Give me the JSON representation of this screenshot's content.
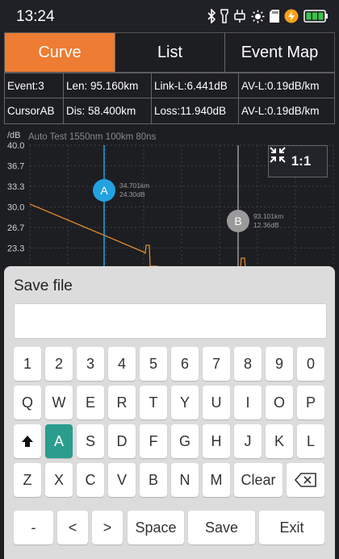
{
  "status": {
    "time": "13:24",
    "icons": [
      "bluetooth-icon",
      "flashlight-icon",
      "plug-icon",
      "brightness-icon",
      "sd-card-icon",
      "charging-icon",
      "battery-icon"
    ],
    "battery_color": "#3ec24a"
  },
  "tabs": [
    {
      "label": "Curve",
      "active": true
    },
    {
      "label": "List",
      "active": false
    },
    {
      "label": "Event Map",
      "active": false
    }
  ],
  "info": {
    "row1": [
      "Event:3",
      "Len: 95.160km",
      "Link-L:6.441dB",
      "AV-L:0.19dB/km"
    ],
    "row2": [
      "CursorAB",
      "Dis:  58.400km",
      "Loss:11.940dB",
      "AV-L:0.19dB/km"
    ]
  },
  "chart_data": {
    "type": "line",
    "title": "Auto Test  1550nm  100km  80ns",
    "ylabel": "/dB",
    "y_ticks": [
      "40.0",
      "36.7",
      "33.3",
      "30.0",
      "26.7",
      "23.3"
    ],
    "ylim": [
      20.0,
      40.0
    ],
    "grid": true,
    "cursors": [
      {
        "name": "A",
        "distance": "34.701km",
        "loss": "24.30dB",
        "color": "#23a2e0"
      },
      {
        "name": "B",
        "distance": "93.101km",
        "loss": "12.36dB",
        "color": "#9a9a9a"
      }
    ],
    "trace_color": "#e08a2c",
    "zoom_label": "1:1"
  },
  "dialog": {
    "title": "Save file",
    "filename_value": "",
    "accent": "#2a9d8f"
  },
  "keyboard": {
    "row1": [
      "1",
      "2",
      "3",
      "4",
      "5",
      "6",
      "7",
      "8",
      "9",
      "0"
    ],
    "row2": [
      "Q",
      "W",
      "E",
      "R",
      "T",
      "Y",
      "U",
      "I",
      "O",
      "P"
    ],
    "row3": [
      "A",
      "S",
      "D",
      "F",
      "G",
      "H",
      "J",
      "K",
      "L"
    ],
    "row4": [
      "Z",
      "X",
      "C",
      "V",
      "B",
      "N",
      "M"
    ],
    "clear_label": "Clear",
    "row5": [
      "-",
      "<",
      ">"
    ],
    "space_label": "Space",
    "save_label": "Save",
    "exit_label": "Exit",
    "selected_key": "A"
  }
}
